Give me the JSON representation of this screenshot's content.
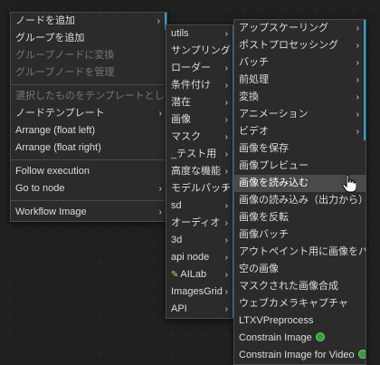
{
  "menu1": [
    {
      "label": "ノードを追加",
      "arrow": "›",
      "sub": true
    },
    {
      "label": "グループを追加"
    },
    {
      "label": "グループノードに変換",
      "disabled": true
    },
    {
      "label": "グループノードを管理",
      "disabled": true
    },
    {
      "sep": true
    },
    {
      "label": "選択したものをテンプレートとして保存",
      "disabled": true
    },
    {
      "label": "ノードテンプレート",
      "arrow": "›",
      "sub": false
    },
    {
      "label": "Arrange (float left)"
    },
    {
      "label": "Arrange (float right)"
    },
    {
      "sep": true
    },
    {
      "label": "Follow execution"
    },
    {
      "label": "Go to node",
      "arrow": "›"
    },
    {
      "sep": true
    },
    {
      "label": "Workflow Image",
      "arrow": "›"
    }
  ],
  "menu2": [
    {
      "label": "utils",
      "arrow": "›",
      "sub": true
    },
    {
      "label": "サンプリング",
      "arrow": "›",
      "sub": true
    },
    {
      "label": "ローダー",
      "arrow": "›",
      "sub": true
    },
    {
      "label": "条件付け",
      "arrow": "›",
      "sub": true
    },
    {
      "label": "潜在",
      "arrow": "›",
      "sub": true
    },
    {
      "label": "画像",
      "arrow": "›",
      "sub": true
    },
    {
      "label": "マスク",
      "arrow": "›",
      "sub": true
    },
    {
      "label": "_テスト用",
      "arrow": "›",
      "sub": true
    },
    {
      "label": "高度な機能",
      "arrow": "›",
      "sub": true
    },
    {
      "label": "モデルパッチ",
      "arrow": "›",
      "sub": true
    },
    {
      "label": "sd",
      "arrow": "›",
      "sub": true
    },
    {
      "label": "オーディオ",
      "arrow": "›",
      "sub": true
    },
    {
      "label": "3d",
      "arrow": "›",
      "sub": true
    },
    {
      "label": "api node",
      "arrow": "›",
      "sub": true
    },
    {
      "label": "AILab",
      "arrow": "›",
      "sub": true,
      "icon": "pencil"
    },
    {
      "label": "ImagesGrid",
      "arrow": "›",
      "sub": true
    },
    {
      "label": "API",
      "arrow": "›",
      "sub": true
    }
  ],
  "menu3": [
    {
      "label": "アップスケーリング",
      "arrow": "›",
      "sub": true
    },
    {
      "label": "ポストプロセッシング",
      "arrow": "›",
      "sub": true
    },
    {
      "label": "バッチ",
      "arrow": "›",
      "sub": true
    },
    {
      "label": "前処理",
      "arrow": "›",
      "sub": true
    },
    {
      "label": "変換",
      "arrow": "›",
      "sub": true
    },
    {
      "label": "アニメーション",
      "arrow": "›",
      "sub": true
    },
    {
      "label": "ビデオ",
      "arrow": "›",
      "sub": true
    },
    {
      "label": "画像を保存"
    },
    {
      "label": "画像プレビュー"
    },
    {
      "label": "画像を読み込む",
      "hover": true
    },
    {
      "label": "画像の読み込み（出力から）"
    },
    {
      "label": "画像を反転"
    },
    {
      "label": "画像バッチ"
    },
    {
      "label": "アウトペイント用に画像をパッド"
    },
    {
      "label": "空の画像"
    },
    {
      "label": "マスクされた画像合成"
    },
    {
      "label": "ウェブカメラキャプチャ"
    },
    {
      "label": "LTXVPreprocess"
    },
    {
      "label": "Constrain Image",
      "badge": true
    },
    {
      "label": "Constrain Image for Video",
      "badge": true
    }
  ]
}
